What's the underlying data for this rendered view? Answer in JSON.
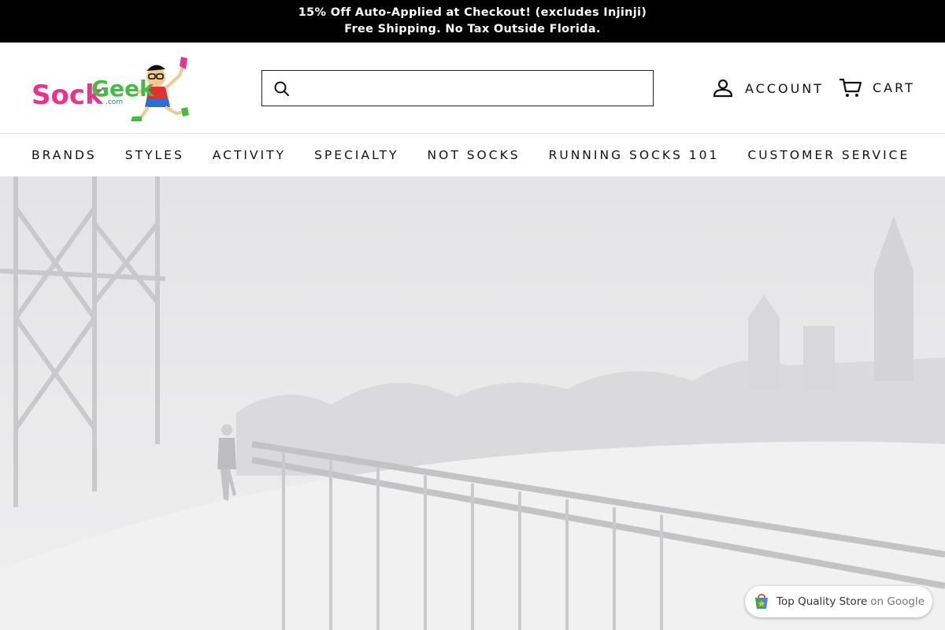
{
  "announcement": {
    "line1": "15% Off Auto-Applied at Checkout! (excludes Injinji)",
    "line2": "Free Shipping. No Tax Outside Florida."
  },
  "header": {
    "logo_text": "SockGeek",
    "logo_suffix": ".com",
    "search": {
      "value": "",
      "placeholder": ""
    },
    "account_label": "ACCOUNT",
    "cart_label": "CART"
  },
  "nav": {
    "items": [
      {
        "label": "BRANDS"
      },
      {
        "label": "STYLES"
      },
      {
        "label": "ACTIVITY"
      },
      {
        "label": "SPECIALTY"
      },
      {
        "label": "NOT SOCKS"
      },
      {
        "label": "RUNNING SOCKS 101"
      },
      {
        "label": "CUSTOMER SERVICE"
      }
    ]
  },
  "hero": {
    "scene": "snowy-bridge-runner"
  },
  "badge": {
    "primary": "Top Quality Store",
    "secondary": "on Google"
  },
  "colors": {
    "announcement_bg": "#000000",
    "logo_pink": "#e8348f",
    "logo_green": "#3fbf3f",
    "logo_blue": "#2a6fd6"
  }
}
